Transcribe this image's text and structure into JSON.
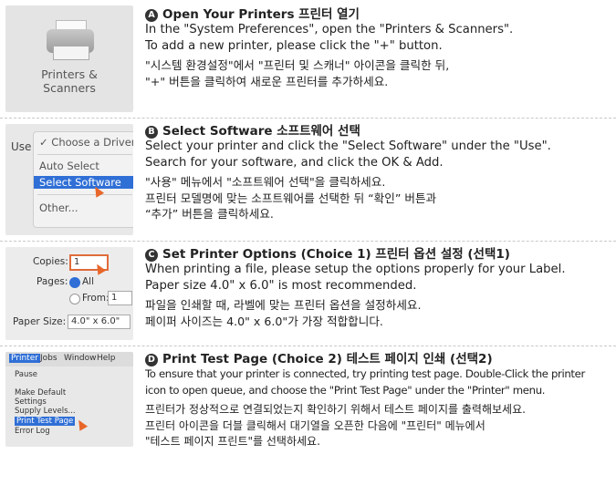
{
  "steps": [
    {
      "badge": "A",
      "title": "Open Your Printers 프린터 열기",
      "en": [
        "In the \"System Preferences\", open the \"Printers & Scanners\".",
        "To add a new printer, please click the \"+\" button."
      ],
      "ko": [
        "\"시스템 환경설정\"에서 \"프린터 및 스캐너\" 아이콘을 클릭한 뒤,",
        "\"+\" 버튼을 클릭하여 새로운 프린터를 추가하세요."
      ],
      "picture": {
        "label_line1": "Printers &",
        "label_line2": "Scanners",
        "icon": "printer-icon"
      }
    },
    {
      "badge": "B",
      "title": "Select Software 소프트웨어 선택",
      "en": [
        "Select your printer and click the \"Select Software\" under the \"Use\".",
        "Search for your software, and click the OK & Add."
      ],
      "ko": [
        "\"사용\" 메뉴에서 \"소프트웨어 선택\"을 클릭하세요.",
        "프린터 모델명에 맞는 소프트웨어를 선택한 뒤 “확인” 버튼과",
        "“추가” 버튼을 클릭하세요."
      ],
      "picture": {
        "use_label": "Use",
        "menu_items": [
          "✓ Choose a Driver",
          "Auto Select",
          "Select Software",
          "Other..."
        ]
      }
    },
    {
      "badge": "C",
      "title": "Set Printer Options (Choice 1) 프린터 옵션 설정 (선택1)",
      "en": [
        "When printing a file, please setup the options properly for your Label.",
        "Paper size 4.0\" x 6.0\" is most recommended."
      ],
      "ko": [
        "파일을 인쇄할 때, 라벨에 맞는 프린터 옵션을 설정하세요.",
        "페이퍼 사이즈는 4.0\" x 6.0\"가 가장 적합합니다."
      ],
      "picture": {
        "copies_label": "Copies:",
        "copies_value": "1",
        "pages_label": "Pages:",
        "all_label": "All",
        "from_label": "From:",
        "from_value": "1",
        "paper_label": "Paper Size:",
        "paper_value": "4.0\" x 6.0\""
      }
    },
    {
      "badge": "D",
      "title": "Print Test Page (Choice 2) 테스트 페이지 인쇄 (선택2)",
      "en": [
        "To ensure that your printer is connected, try printing test page. Double-Click the printer",
        "icon to open queue, and choose the \"Print Test Page\" under the \"Printer\" menu."
      ],
      "ko": [
        "프린터가 정상적으로 연결되었는지 확인하기 위해서 테스트 페이지를 출력해보세요.",
        "프린터 아이콘을 더블 클릭해서 대기열을 오픈한 다음에 \"프린터\" 메뉴에서",
        "\"테스트 페이지 프린트\"를 선택하세요."
      ],
      "picture": {
        "menubar": [
          "Printer",
          "Jobs",
          "Window",
          "Help"
        ],
        "items": [
          "Pause",
          "Make Default",
          "Settings",
          "Supply Levels...",
          "Print Test Page",
          "Error Log"
        ]
      }
    }
  ]
}
